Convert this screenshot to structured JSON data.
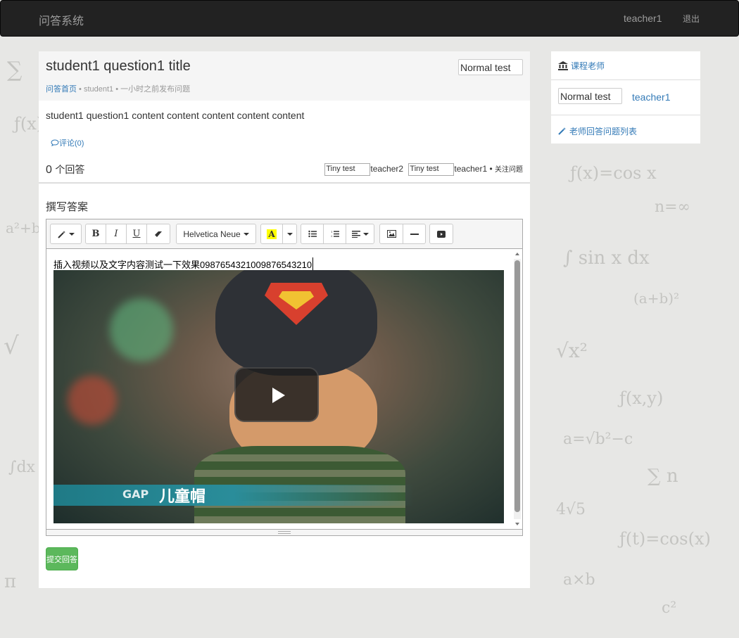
{
  "navbar": {
    "brand": "问答系统",
    "user": "teacher1",
    "logout": "退出"
  },
  "question": {
    "title": "student1 question1 title",
    "breadcrumb": "问答首页",
    "author": "student1",
    "time": "一小时之前发布问题",
    "author_img_alt": "Normal test",
    "content": "student1 question1 content content content content content",
    "comments": "评论(0)"
  },
  "answers": {
    "count": "0",
    "count_label": "个回答",
    "voters": [
      {
        "img_alt": "Tiny test",
        "name": "teacher2"
      },
      {
        "img_alt": "Tiny test",
        "name": "teacher1"
      }
    ],
    "voters_suffix": "关注问题"
  },
  "answer_form": {
    "title": "撰写答案",
    "font_name": "Helvetica Neue",
    "highlight_glyph": "A",
    "editor_text": "插入视频以及文字内容测试一下效果0987654321009876543210",
    "video_caption_brand": "GAP",
    "video_caption_text": "儿童帽",
    "submit_label": "提交回答"
  },
  "sidebar": {
    "section_title": "课程老师",
    "teacher_img_alt": "Normal test",
    "teacher_name": "teacher1",
    "link": "老师回答问题列表"
  },
  "colors": {
    "primary": "#337ab7",
    "success": "#5cb85c",
    "navbar": "#222222"
  },
  "icons": [
    "bank-icon",
    "magic-wand-icon",
    "comment-icon",
    "bold-icon",
    "italic-icon",
    "underline-icon",
    "eraser-icon",
    "list-ul-icon",
    "list-ol-icon",
    "align-icon",
    "picture-icon",
    "hr-icon",
    "video-icon",
    "play-icon"
  ]
}
